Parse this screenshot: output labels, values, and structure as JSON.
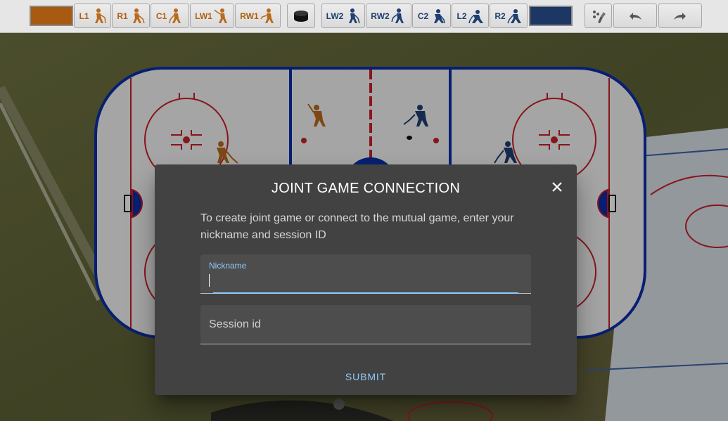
{
  "toolbar": {
    "team1_color": "#a85a10",
    "team2_color": "#1c3764",
    "team1_players": [
      "L1",
      "R1",
      "C1",
      "LW1",
      "RW1"
    ],
    "team2_players": [
      "LW2",
      "RW2",
      "C2",
      "L2",
      "R2"
    ],
    "puck_icon": "puck-icon",
    "tools": [
      "draw-tool-icon",
      "undo-icon",
      "redo-icon"
    ]
  },
  "colors": {
    "team1": "#b86a1c",
    "team2": "#1f3f70",
    "rink_red": "#c8202a",
    "rink_blue": "#0b2fa8",
    "dialog_bg": "#424242",
    "accent": "#90caf9"
  },
  "dialog": {
    "title": "JOINT GAME CONNECTION",
    "description": "To create joint game or connect to the mutual game, enter your nickname and session ID",
    "nickname_label": "Nickname",
    "nickname_value": "",
    "session_placeholder": "Session id",
    "session_value": "",
    "submit_label": "SUBMIT",
    "close_icon": "close-icon"
  }
}
